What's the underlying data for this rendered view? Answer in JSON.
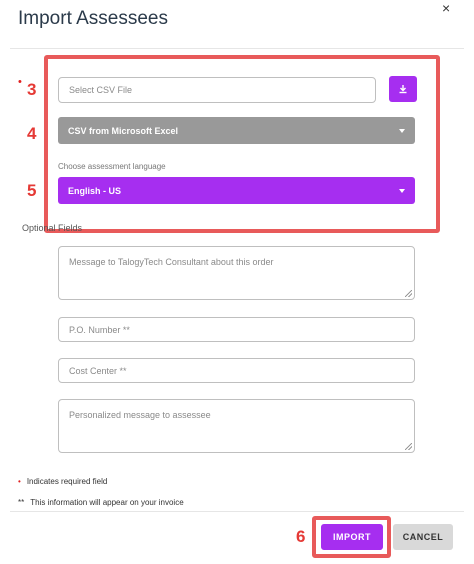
{
  "dialog": {
    "title": "Import Assessees",
    "close_glyph": "×"
  },
  "annotations": {
    "step3": "3",
    "step4": "4",
    "step5": "5",
    "step6": "6",
    "color": "#e53935"
  },
  "form": {
    "required_marker": "•",
    "csv_file_placeholder": "Select CSV File",
    "download_icon": "download-icon",
    "file_format_value": "CSV from Microsoft Excel",
    "language_label": "Choose assessment language",
    "language_value": "English - US",
    "optional_fields_label": "Optional Fields",
    "message_placeholder": "Message to TalogyTech Consultant about this order",
    "po_number_placeholder": "P.O. Number **",
    "cost_center_placeholder": "Cost Center **",
    "assessee_message_placeholder": "Personalized message to assessee"
  },
  "footnotes": {
    "required_star": "•",
    "required_text": "Indicates required field",
    "invoice_marker": "**",
    "invoice_text": "This information will appear on your invoice"
  },
  "buttons": {
    "import_label": "IMPORT",
    "cancel_label": "CANCEL"
  },
  "colors": {
    "accent": "#a62ef0",
    "select_gray": "#999999",
    "annotation_red": "#e85a5a"
  }
}
